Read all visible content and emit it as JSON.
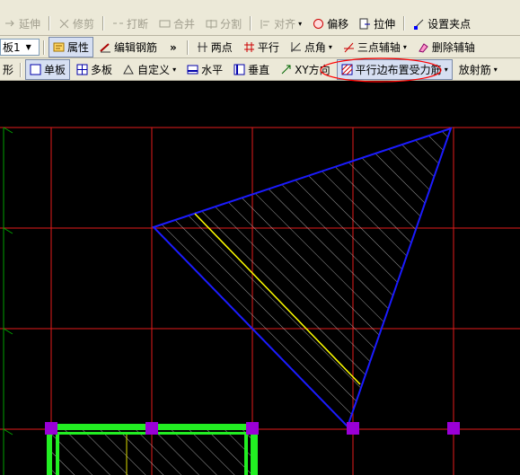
{
  "toolbar1": {
    "items": [
      {
        "label": "延伸",
        "enabled": false
      },
      {
        "label": "修剪",
        "enabled": false
      },
      {
        "label": "打断",
        "enabled": false
      },
      {
        "label": "合并",
        "enabled": false
      },
      {
        "label": "分割",
        "enabled": false
      },
      {
        "label": "对齐",
        "enabled": false
      },
      {
        "label": "偏移",
        "enabled": true
      },
      {
        "label": "拉伸",
        "enabled": true
      },
      {
        "label": "设置夹点",
        "enabled": true
      }
    ]
  },
  "toolbar2": {
    "slab_select": "板1",
    "properties": "属性",
    "edit_rebar": "编辑钢筋",
    "more": "»",
    "two_points": "两点",
    "parallel": "平行",
    "point_angle": "点角",
    "three_point_axis": "三点辅轴",
    "delete_axis": "删除辅轴"
  },
  "toolbar3": {
    "shape_prefix": "形",
    "single_slab": "单板",
    "multi_slab": "多板",
    "custom": "自定义",
    "horizontal": "水平",
    "vertical": "垂直",
    "xy_direction": "XY方向",
    "parallel_edge_rebar": "平行边布置受力筋",
    "radial_rebar": "放射筋"
  },
  "colors": {
    "background": "#000000",
    "grid_lines": "#e31b1b",
    "slab_outline": "#1b1bff",
    "rebar_line": "#ffff00",
    "hatch": "#c8c8c8",
    "beam": "#22ee22",
    "grip_points": "#9a00d6",
    "axis_ticks": "#00a000",
    "annotation_ellipse": "#ff0000"
  }
}
